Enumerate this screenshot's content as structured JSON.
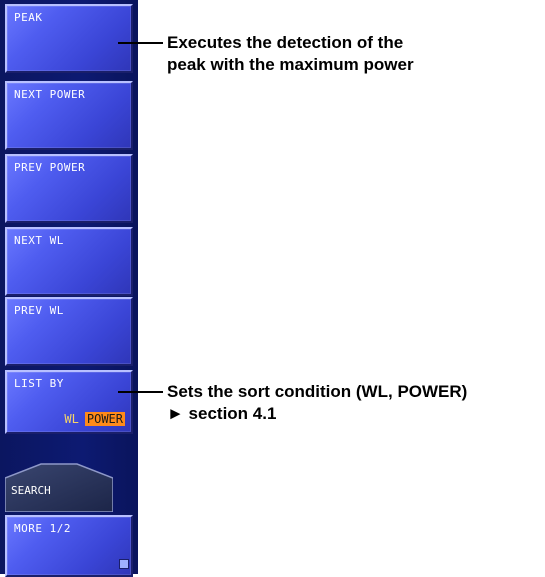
{
  "softkeys": [
    {
      "label": "PEAK"
    },
    {
      "label": "NEXT POWER"
    },
    {
      "label": "PREV POWER"
    },
    {
      "label": "NEXT WL"
    },
    {
      "label": "PREV WL"
    },
    {
      "label": "LIST BY",
      "options": [
        "WL",
        "POWER"
      ],
      "selected": "POWER"
    }
  ],
  "search_tab": {
    "label": "SEARCH"
  },
  "more_key": {
    "label": "MORE 1/2"
  },
  "callouts": {
    "peak": {
      "line1": "Executes the detection of the",
      "line2": "peak with the maximum power"
    },
    "list_by": {
      "line1": "Sets the sort condition (WL, POWER)",
      "line2": "► section 4.1"
    }
  },
  "colors": {
    "panel_bg": "#0d1a72",
    "key_face": "#4f5df0",
    "selected_option_bg": "#ff8a1a",
    "unselected_option": "#f3d46a"
  }
}
